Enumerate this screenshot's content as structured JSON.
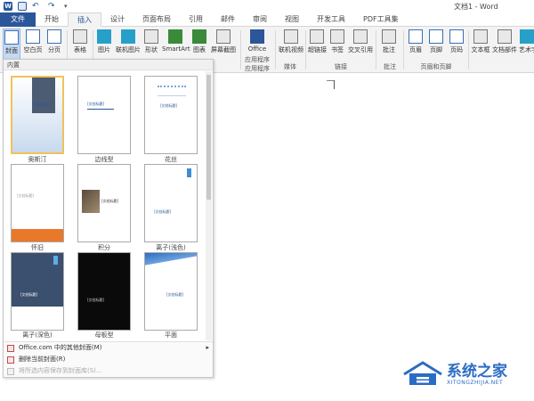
{
  "window": {
    "title": "文档1 - Word"
  },
  "qat": {
    "word": "W",
    "undo": "↶",
    "redo": "↷",
    "more": "▾"
  },
  "tabs": [
    {
      "label": "文件"
    },
    {
      "label": "开始"
    },
    {
      "label": "插入"
    },
    {
      "label": "设计"
    },
    {
      "label": "页面布局"
    },
    {
      "label": "引用"
    },
    {
      "label": "邮件"
    },
    {
      "label": "审阅"
    },
    {
      "label": "视图"
    },
    {
      "label": "开发工具"
    },
    {
      "label": "PDF工具集"
    }
  ],
  "ribbon": {
    "buttons": {
      "cover": "封面",
      "blank": "空白页",
      "pagebreak": "分页",
      "table": "表格",
      "picture": "图片",
      "online_picture": "联机图片",
      "shapes": "形状",
      "smartart": "SmartArt",
      "chart": "图表",
      "screenshot": "屏幕截图",
      "office_apps_1": "Office",
      "office_apps_2": "应用程序",
      "online_video": "联机视频",
      "hyperlink": "超链接",
      "bookmark": "书签",
      "crossref": "交叉引用",
      "comment": "批注",
      "header": "页眉",
      "footer": "页脚",
      "pagenum": "页码",
      "textbox": "文本框",
      "quickparts": "文档部件",
      "wordart": "艺术字"
    },
    "groups": {
      "apps": "应用程序",
      "media": "媒体",
      "links": "链接",
      "comments": "批注",
      "header_footer": "页眉和页脚"
    }
  },
  "gallery": {
    "heading": "内置",
    "covers": [
      {
        "label": "奥斯汀",
        "title": "[文档标题]"
      },
      {
        "label": "边线型",
        "title": "[文档标题]"
      },
      {
        "label": "花丝",
        "title": "[文档标题]"
      },
      {
        "label": "怀旧",
        "title": "[文档标题]"
      },
      {
        "label": "积分",
        "title": "[文档标题]"
      },
      {
        "label": "离子(浅色)",
        "title": "[文档标题]"
      },
      {
        "label": "离子(深色)",
        "title": "[文档标题]"
      },
      {
        "label": "母板型",
        "title": "[文档标题]"
      },
      {
        "label": "平面",
        "title": "[文档标题]"
      }
    ],
    "menu": [
      {
        "label": "Office.com 中的其他封面(M)",
        "has_submenu": true,
        "disabled": false
      },
      {
        "label": "删除当前封面(R)",
        "has_submenu": false,
        "disabled": false
      },
      {
        "label": "将所选内容保存到封面库(S)...",
        "has_submenu": false,
        "disabled": true
      }
    ],
    "submenu_arrow": "▸"
  },
  "watermark": {
    "text": "系统之家",
    "sub": "XITONGZHIJIA.NET"
  },
  "colors": {
    "accent": "#2b579a",
    "ribbon_bg": "#f3f3f3",
    "selected_cover": "#f0c25a"
  }
}
